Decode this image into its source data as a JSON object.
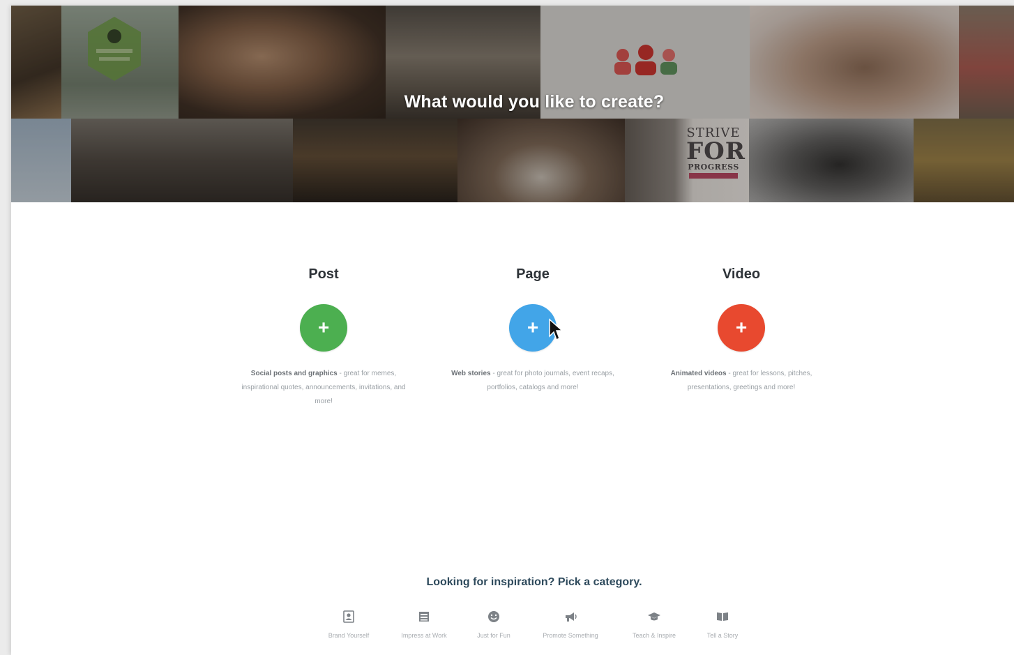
{
  "hero": {
    "title": "What would you like to create?",
    "poster_text": {
      "line1": "STRIVE",
      "line2": "FOR",
      "line3": "PROGRESS"
    }
  },
  "options": [
    {
      "title": "Post",
      "color": "#4caf50",
      "desc_bold": "Social posts and graphics",
      "desc_rest": " - great for memes, inspirational quotes, announcements, invitations, and more!"
    },
    {
      "title": "Page",
      "color": "#42a5e8",
      "desc_bold": "Web stories",
      "desc_rest": " - great for photo journals, event recaps, portfolios, catalogs and more!"
    },
    {
      "title": "Video",
      "color": "#e8492f",
      "desc_bold": "Animated videos",
      "desc_rest": " - great for lessons, pitches, presentations, greetings and more!"
    }
  ],
  "inspiration": {
    "title": "Looking for inspiration? Pick a category.",
    "categories": [
      {
        "label": "Brand Yourself",
        "icon": "id-card-icon"
      },
      {
        "label": "Impress at Work",
        "icon": "briefcase-icon"
      },
      {
        "label": "Just for Fun",
        "icon": "smiley-icon"
      },
      {
        "label": "Promote Something",
        "icon": "megaphone-icon"
      },
      {
        "label": "Teach & Inspire",
        "icon": "graduation-cap-icon"
      },
      {
        "label": "Tell a Story",
        "icon": "book-icon"
      }
    ]
  },
  "colors": {
    "post": "#4caf50",
    "page": "#42a5e8",
    "video": "#e8492f"
  }
}
